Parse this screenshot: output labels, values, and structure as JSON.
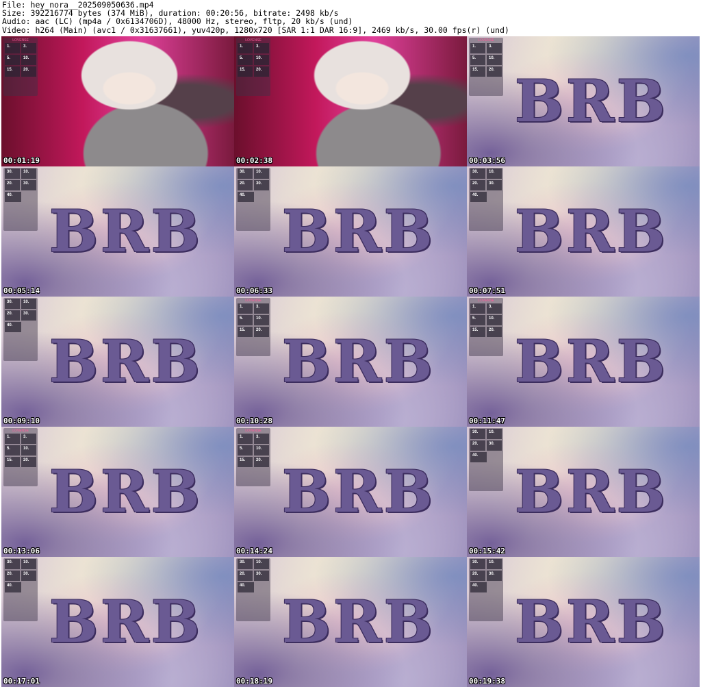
{
  "header": {
    "file_line": "File: hey_nora__202509050636.mp4",
    "size_line": "Size: 392216774 bytes (374 MiB), duration: 00:20:56, bitrate: 2498 kb/s",
    "audio_line": "Audio: aac (LC) (mp4a / 0x6134706D), 48000 Hz, stereo, fltp, 20 kb/s (und)",
    "video_line": "Video: h264 (Main) (avc1 / 0x31637661), yuv420p, 1280x720 [SAR 1:1 DAR 16:9], 2469 kb/s, 30.00 fps(r) (und)"
  },
  "thumbnails": [
    {
      "time": "00:01:19",
      "scene": "cam",
      "overlay": "lovense"
    },
    {
      "time": "00:02:38",
      "scene": "cam",
      "overlay": "lovense"
    },
    {
      "time": "00:03:56",
      "scene": "brb",
      "overlay": "lovense"
    },
    {
      "time": "00:05:14",
      "scene": "brb",
      "overlay": "alt"
    },
    {
      "time": "00:06:33",
      "scene": "brb",
      "overlay": "alt"
    },
    {
      "time": "00:07:51",
      "scene": "brb",
      "overlay": "alt"
    },
    {
      "time": "00:09:10",
      "scene": "brb",
      "overlay": "alt"
    },
    {
      "time": "00:10:28",
      "scene": "brb",
      "overlay": "lovense"
    },
    {
      "time": "00:11:47",
      "scene": "brb",
      "overlay": "lovense"
    },
    {
      "time": "00:13:06",
      "scene": "brb",
      "overlay": "lovense"
    },
    {
      "time": "00:14:24",
      "scene": "brb",
      "overlay": "lovense"
    },
    {
      "time": "00:15:42",
      "scene": "brb",
      "overlay": "alt"
    },
    {
      "time": "00:17:01",
      "scene": "brb",
      "overlay": "alt"
    },
    {
      "time": "00:18:19",
      "scene": "brb",
      "overlay": "alt"
    },
    {
      "time": "00:19:38",
      "scene": "brb",
      "overlay": "alt"
    }
  ],
  "brb_text": "BRB",
  "overlay_lovense": {
    "title": "LOVENSE",
    "values": [
      "1.",
      "3.",
      "5.",
      "10.",
      "15.",
      "20."
    ]
  },
  "overlay_alt": {
    "values": [
      "30.",
      "10.",
      "20.",
      "30.",
      "40."
    ]
  }
}
